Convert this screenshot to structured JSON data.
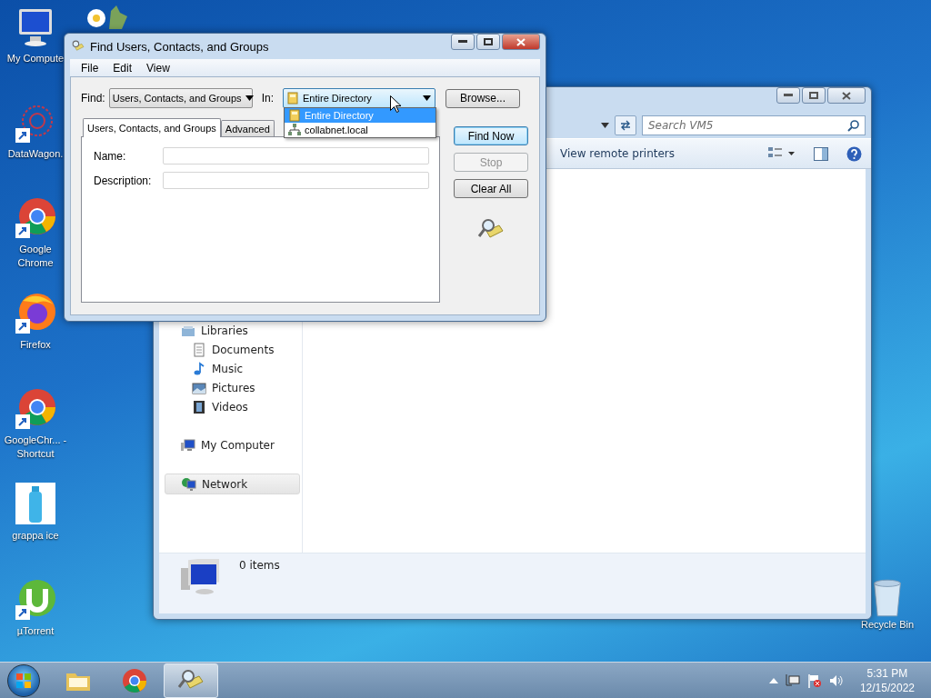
{
  "desktop_icons": [
    {
      "kind": "computer",
      "label": "My Compute"
    },
    {
      "kind": "network-art",
      "label": "DataWagon."
    },
    {
      "kind": "chrome",
      "label": "Google Chrome"
    },
    {
      "kind": "firefox",
      "label": "Firefox"
    },
    {
      "kind": "chrome",
      "label": "GoogleChr... - Shortcut"
    },
    {
      "kind": "bottle",
      "label": "grappa ice"
    },
    {
      "kind": "torrent",
      "label": "µTorrent"
    }
  ],
  "recycle_bin": {
    "label": "Recycle Bin"
  },
  "explorer": {
    "search": {
      "placeholder": "Search VM5"
    },
    "toolbar": [
      "View remote printers"
    ],
    "nav": [
      {
        "kind": "library",
        "label": "Libraries",
        "selected": false,
        "children": [
          {
            "kind": "documents",
            "label": "Documents",
            "selected": false
          },
          {
            "kind": "music",
            "label": "Music",
            "selected": false
          },
          {
            "kind": "pictures",
            "label": "Pictures",
            "selected": false
          },
          {
            "kind": "videos",
            "label": "Videos",
            "selected": false
          }
        ]
      },
      {
        "kind": "computer",
        "label": "My Computer",
        "selected": false
      },
      {
        "kind": "network",
        "label": "Network",
        "selected": true
      }
    ],
    "status": "0 items"
  },
  "find_dialog": {
    "title": "Find Users, Contacts, and Groups",
    "menus": [
      "File",
      "Edit",
      "View"
    ],
    "find_label": "Find:",
    "find_value": "Users, Contacts, and Groups",
    "in_label": "In:",
    "in_value": "Entire Directory",
    "browse": "Browse...",
    "in_options": [
      {
        "label": "Entire Directory",
        "kind": "directory",
        "selected": true
      },
      {
        "label": "collabnet.local",
        "kind": "domain",
        "selected": false
      }
    ],
    "tabs": [
      {
        "label": "Users, Contacts, and Groups",
        "selected": true
      },
      {
        "label": "Advanced",
        "selected": false
      }
    ],
    "fields": [
      {
        "label": "Name:"
      },
      {
        "label": "Description:"
      }
    ],
    "buttons": [
      {
        "label": "Find Now",
        "default": true,
        "disabled": false
      },
      {
        "label": "Stop",
        "default": false,
        "disabled": true
      },
      {
        "label": "Clear All",
        "default": false,
        "disabled": false
      }
    ]
  },
  "taskbar": {
    "items": [
      {
        "kind": "folder",
        "active": false
      },
      {
        "kind": "chrome",
        "active": false
      },
      {
        "kind": "find",
        "active": true
      }
    ],
    "time": "5:31 PM",
    "date": "12/15/2022"
  }
}
